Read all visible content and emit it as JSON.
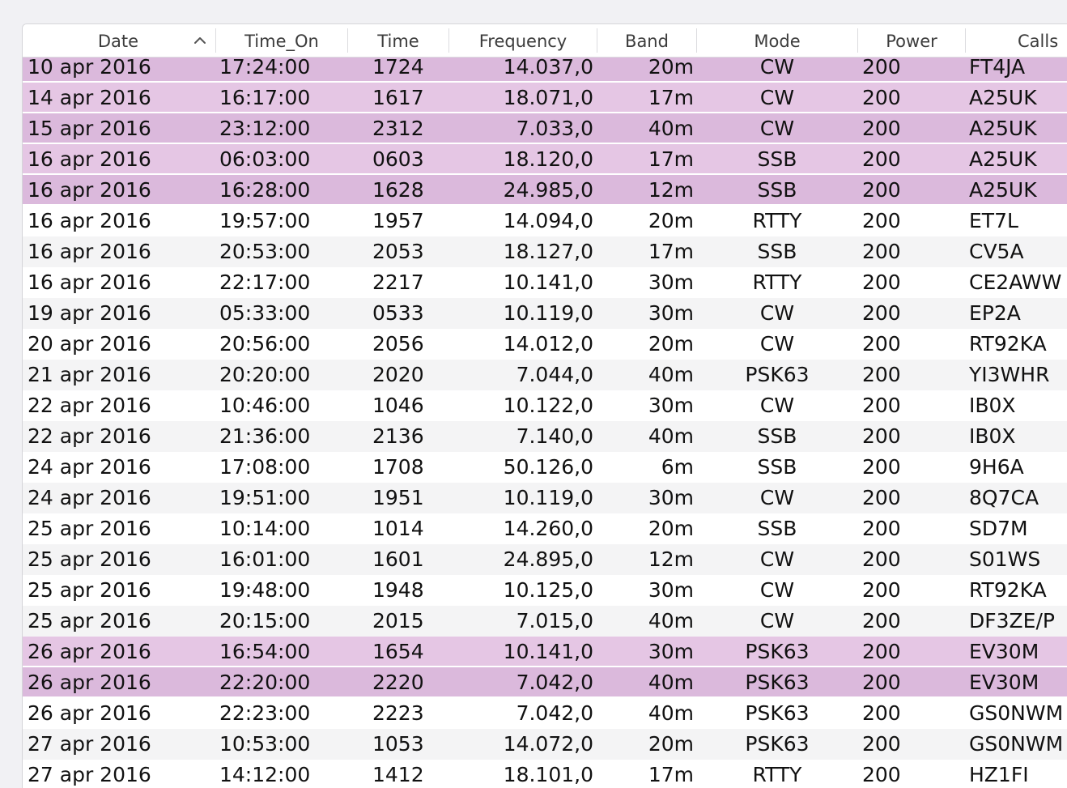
{
  "table": {
    "columns": [
      {
        "key": "date",
        "label": "Date",
        "sorted": "ascending"
      },
      {
        "key": "time_on",
        "label": "Time_On"
      },
      {
        "key": "time",
        "label": "Time"
      },
      {
        "key": "frequency",
        "label": "Frequency"
      },
      {
        "key": "band",
        "label": "Band"
      },
      {
        "key": "mode",
        "label": "Mode"
      },
      {
        "key": "power",
        "label": "Power"
      },
      {
        "key": "call",
        "label": "Calls"
      }
    ],
    "rows": [
      {
        "date": "10 apr 2016",
        "time_on": "17:24:00",
        "time": "1724",
        "frequency": "14.037,0",
        "band": "20m",
        "mode": "CW",
        "power": "200",
        "call": "FT4JA",
        "selected": true
      },
      {
        "date": "14 apr 2016",
        "time_on": "16:17:00",
        "time": "1617",
        "frequency": "18.071,0",
        "band": "17m",
        "mode": "CW",
        "power": "200",
        "call": "A25UK",
        "selected": true
      },
      {
        "date": "15 apr 2016",
        "time_on": "23:12:00",
        "time": "2312",
        "frequency": "7.033,0",
        "band": "40m",
        "mode": "CW",
        "power": "200",
        "call": "A25UK",
        "selected": true
      },
      {
        "date": "16 apr 2016",
        "time_on": "06:03:00",
        "time": "0603",
        "frequency": "18.120,0",
        "band": "17m",
        "mode": "SSB",
        "power": "200",
        "call": "A25UK",
        "selected": true
      },
      {
        "date": "16 apr 2016",
        "time_on": "16:28:00",
        "time": "1628",
        "frequency": "24.985,0",
        "band": "12m",
        "mode": "SSB",
        "power": "200",
        "call": "A25UK",
        "selected": true
      },
      {
        "date": "16 apr 2016",
        "time_on": "19:57:00",
        "time": "1957",
        "frequency": "14.094,0",
        "band": "20m",
        "mode": "RTTY",
        "power": "200",
        "call": "ET7L",
        "selected": false
      },
      {
        "date": "16 apr 2016",
        "time_on": "20:53:00",
        "time": "2053",
        "frequency": "18.127,0",
        "band": "17m",
        "mode": "SSB",
        "power": "200",
        "call": "CV5A",
        "selected": false
      },
      {
        "date": "16 apr 2016",
        "time_on": "22:17:00",
        "time": "2217",
        "frequency": "10.141,0",
        "band": "30m",
        "mode": "RTTY",
        "power": "200",
        "call": "CE2AWW",
        "selected": false
      },
      {
        "date": "19 apr 2016",
        "time_on": "05:33:00",
        "time": "0533",
        "frequency": "10.119,0",
        "band": "30m",
        "mode": "CW",
        "power": "200",
        "call": "EP2A",
        "selected": false
      },
      {
        "date": "20 apr 2016",
        "time_on": "20:56:00",
        "time": "2056",
        "frequency": "14.012,0",
        "band": "20m",
        "mode": "CW",
        "power": "200",
        "call": "RT92KA",
        "selected": false
      },
      {
        "date": "21 apr 2016",
        "time_on": "20:20:00",
        "time": "2020",
        "frequency": "7.044,0",
        "band": "40m",
        "mode": "PSK63",
        "power": "200",
        "call": "YI3WHR",
        "selected": false
      },
      {
        "date": "22 apr 2016",
        "time_on": "10:46:00",
        "time": "1046",
        "frequency": "10.122,0",
        "band": "30m",
        "mode": "CW",
        "power": "200",
        "call": "IB0X",
        "selected": false
      },
      {
        "date": "22 apr 2016",
        "time_on": "21:36:00",
        "time": "2136",
        "frequency": "7.140,0",
        "band": "40m",
        "mode": "SSB",
        "power": "200",
        "call": "IB0X",
        "selected": false
      },
      {
        "date": "24 apr 2016",
        "time_on": "17:08:00",
        "time": "1708",
        "frequency": "50.126,0",
        "band": "6m",
        "mode": "SSB",
        "power": "200",
        "call": "9H6A",
        "selected": false
      },
      {
        "date": "24 apr 2016",
        "time_on": "19:51:00",
        "time": "1951",
        "frequency": "10.119,0",
        "band": "30m",
        "mode": "CW",
        "power": "200",
        "call": "8Q7CA",
        "selected": false
      },
      {
        "date": "25 apr 2016",
        "time_on": "10:14:00",
        "time": "1014",
        "frequency": "14.260,0",
        "band": "20m",
        "mode": "SSB",
        "power": "200",
        "call": "SD7M",
        "selected": false
      },
      {
        "date": "25 apr 2016",
        "time_on": "16:01:00",
        "time": "1601",
        "frequency": "24.895,0",
        "band": "12m",
        "mode": "CW",
        "power": "200",
        "call": "S01WS",
        "selected": false
      },
      {
        "date": "25 apr 2016",
        "time_on": "19:48:00",
        "time": "1948",
        "frequency": "10.125,0",
        "band": "30m",
        "mode": "CW",
        "power": "200",
        "call": "RT92KA",
        "selected": false
      },
      {
        "date": "25 apr 2016",
        "time_on": "20:15:00",
        "time": "2015",
        "frequency": "7.015,0",
        "band": "40m",
        "mode": "CW",
        "power": "200",
        "call": "DF3ZE/P",
        "selected": false
      },
      {
        "date": "26 apr 2016",
        "time_on": "16:54:00",
        "time": "1654",
        "frequency": "10.141,0",
        "band": "30m",
        "mode": "PSK63",
        "power": "200",
        "call": "EV30M",
        "selected": true
      },
      {
        "date": "26 apr 2016",
        "time_on": "22:20:00",
        "time": "2220",
        "frequency": "7.042,0",
        "band": "40m",
        "mode": "PSK63",
        "power": "200",
        "call": "EV30M",
        "selected": true
      },
      {
        "date": "26 apr 2016",
        "time_on": "22:23:00",
        "time": "2223",
        "frequency": "7.042,0",
        "band": "40m",
        "mode": "PSK63",
        "power": "200",
        "call": "GS0NWM",
        "selected": false
      },
      {
        "date": "27 apr 2016",
        "time_on": "10:53:00",
        "time": "1053",
        "frequency": "14.072,0",
        "band": "20m",
        "mode": "PSK63",
        "power": "200",
        "call": "GS0NWM",
        "selected": false
      },
      {
        "date": "27 apr 2016",
        "time_on": "14:12:00",
        "time": "1412",
        "frequency": "18.101,0",
        "band": "17m",
        "mode": "RTTY",
        "power": "200",
        "call": "HZ1FI",
        "selected": false
      }
    ]
  },
  "colors": {
    "selection": "#dbb9dc",
    "selection_alt": "#e5c6e4",
    "stripe": "#f4f4f5",
    "text": "#111111",
    "header_text": "#3c3c3c"
  },
  "icons": {
    "sort": "chevron-up-icon"
  }
}
